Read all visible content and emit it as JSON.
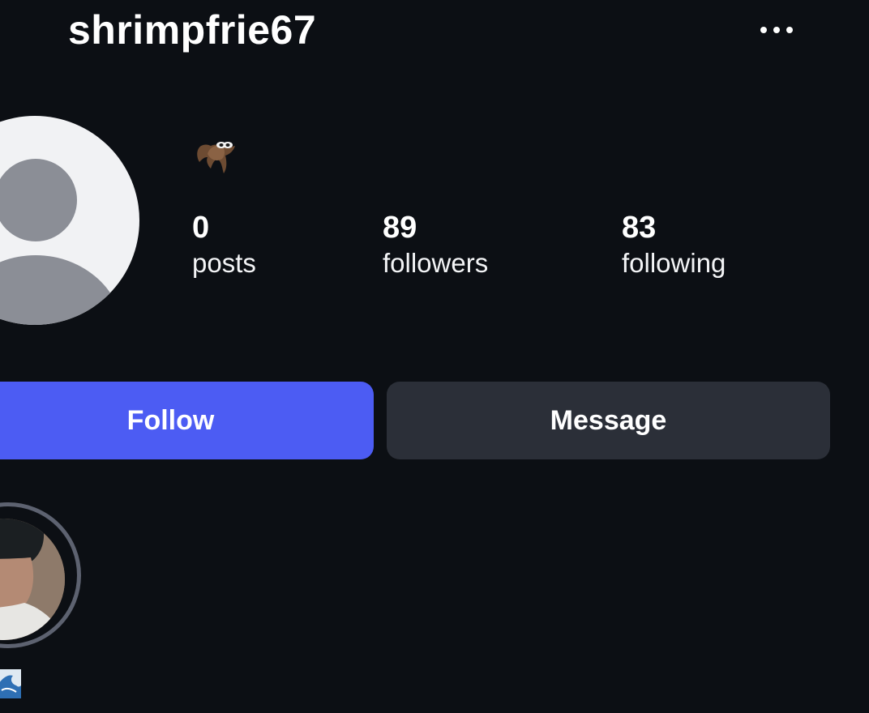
{
  "header": {
    "username": "shrimpfrie67",
    "more_icon": "more-horizontal-icon"
  },
  "profile": {
    "avatar_icon": "default-avatar-icon",
    "bio_icon": "bat-emoji-icon",
    "stats": {
      "posts": {
        "value": "0",
        "label": "posts"
      },
      "followers": {
        "value": "89",
        "label": "followers"
      },
      "following": {
        "value": "83",
        "label": "following"
      }
    }
  },
  "actions": {
    "follow_label": "Follow",
    "message_label": "Message"
  },
  "highlights": {
    "items": [
      {
        "icon": "wave-emoji-icon"
      }
    ]
  },
  "colors": {
    "background": "#0c0f14",
    "follow_button": "#4c5cf3",
    "message_button": "#2b2f38",
    "avatar_placeholder": "#8b8e96"
  }
}
